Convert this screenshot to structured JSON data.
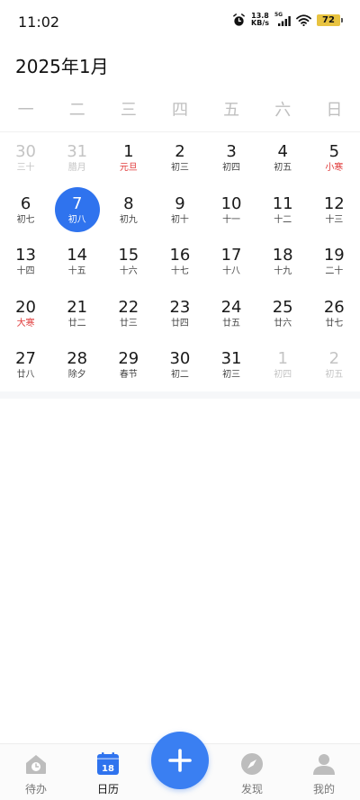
{
  "status_bar": {
    "time": "11:02",
    "net_speed_value": "13.8",
    "net_speed_unit": "KB/s",
    "network_tag": "5G",
    "battery": "72"
  },
  "header": {
    "title": "2025年1月"
  },
  "weekdays": [
    "一",
    "二",
    "三",
    "四",
    "五",
    "六",
    "日"
  ],
  "weeks": [
    [
      {
        "day": "30",
        "lunar": "三十",
        "type": "other"
      },
      {
        "day": "31",
        "lunar": "腊月",
        "type": "other"
      },
      {
        "day": "1",
        "lunar": "元旦",
        "type": "holiday"
      },
      {
        "day": "2",
        "lunar": "初三",
        "type": ""
      },
      {
        "day": "3",
        "lunar": "初四",
        "type": ""
      },
      {
        "day": "4",
        "lunar": "初五",
        "type": ""
      },
      {
        "day": "5",
        "lunar": "小寒",
        "type": "holiday"
      }
    ],
    [
      {
        "day": "6",
        "lunar": "初七",
        "type": ""
      },
      {
        "day": "7",
        "lunar": "初八",
        "type": "selected"
      },
      {
        "day": "8",
        "lunar": "初九",
        "type": ""
      },
      {
        "day": "9",
        "lunar": "初十",
        "type": ""
      },
      {
        "day": "10",
        "lunar": "十一",
        "type": ""
      },
      {
        "day": "11",
        "lunar": "十二",
        "type": ""
      },
      {
        "day": "12",
        "lunar": "十三",
        "type": ""
      }
    ],
    [
      {
        "day": "13",
        "lunar": "十四",
        "type": ""
      },
      {
        "day": "14",
        "lunar": "十五",
        "type": ""
      },
      {
        "day": "15",
        "lunar": "十六",
        "type": ""
      },
      {
        "day": "16",
        "lunar": "十七",
        "type": ""
      },
      {
        "day": "17",
        "lunar": "十八",
        "type": ""
      },
      {
        "day": "18",
        "lunar": "十九",
        "type": ""
      },
      {
        "day": "19",
        "lunar": "二十",
        "type": ""
      }
    ],
    [
      {
        "day": "20",
        "lunar": "大寒",
        "type": "holiday"
      },
      {
        "day": "21",
        "lunar": "廿二",
        "type": ""
      },
      {
        "day": "22",
        "lunar": "廿三",
        "type": ""
      },
      {
        "day": "23",
        "lunar": "廿四",
        "type": ""
      },
      {
        "day": "24",
        "lunar": "廿五",
        "type": ""
      },
      {
        "day": "25",
        "lunar": "廿六",
        "type": ""
      },
      {
        "day": "26",
        "lunar": "廿七",
        "type": ""
      }
    ],
    [
      {
        "day": "27",
        "lunar": "廿八",
        "type": ""
      },
      {
        "day": "28",
        "lunar": "除夕",
        "type": ""
      },
      {
        "day": "29",
        "lunar": "春节",
        "type": ""
      },
      {
        "day": "30",
        "lunar": "初二",
        "type": ""
      },
      {
        "day": "31",
        "lunar": "初三",
        "type": ""
      },
      {
        "day": "1",
        "lunar": "初四",
        "type": "other"
      },
      {
        "day": "2",
        "lunar": "初五",
        "type": "other"
      }
    ]
  ],
  "tabbar": {
    "todo_label": "待办",
    "calendar_label": "日历",
    "calendar_icon_day": "18",
    "discover_label": "发现",
    "mine_label": "我的"
  },
  "colors": {
    "accent": "#2f73ee",
    "holiday": "#e03a3a",
    "muted": "#c4c4c4"
  },
  "icons": {
    "todo": "home-clock-icon",
    "calendar": "calendar-icon",
    "add": "plus-icon",
    "discover": "compass-icon",
    "mine": "person-icon"
  }
}
